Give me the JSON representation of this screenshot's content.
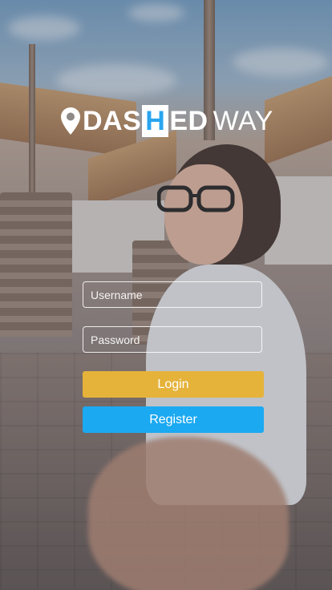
{
  "logo": {
    "icon": "map-pin-icon",
    "part_a": "DAS",
    "part_h": "H",
    "part_b": "ED",
    "part_c": "WAY"
  },
  "form": {
    "username_placeholder": "Username",
    "password_placeholder": "Password",
    "login_label": "Login",
    "register_label": "Register"
  },
  "colors": {
    "login_button": "#e5b33a",
    "register_button": "#1ba9f2",
    "logo_accent": "#2aa5f0"
  }
}
